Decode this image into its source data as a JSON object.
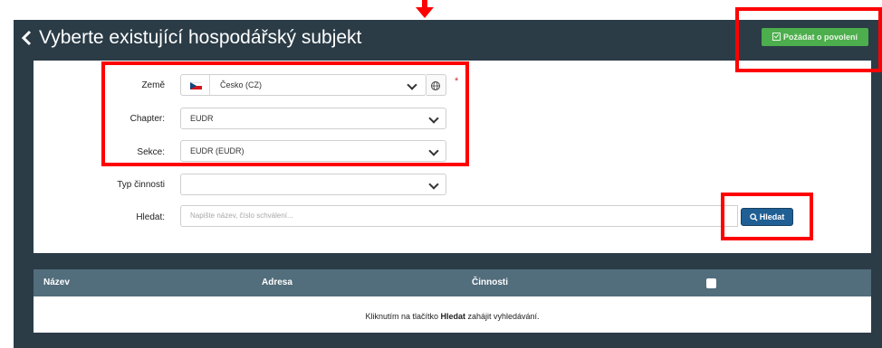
{
  "header": {
    "back_icon": "chevron-left-icon",
    "title": "Vyberte existující hospodářský subjekt",
    "request_permission_label": "Požádat o povolení"
  },
  "form": {
    "country": {
      "label": "Země",
      "value": "Česko (CZ)",
      "flag": "cz-flag-icon",
      "required_mark": "*"
    },
    "chapter": {
      "label": "Chapter:",
      "value": "EUDR"
    },
    "section": {
      "label": "Sekce:",
      "value": "EUDR (EUDR)"
    },
    "activity_type": {
      "label": "Typ činnosti",
      "value": ""
    },
    "search": {
      "label": "Hledat:",
      "placeholder": "Napište název, číslo schválení...",
      "button_label": "Hledat"
    }
  },
  "results": {
    "columns": [
      "Název",
      "Adresa",
      "Činnosti"
    ],
    "empty_message_before": "Kliknutím na tlačítko ",
    "empty_message_bold": "Hledat",
    "empty_message_after": " zahájit vyhledávání."
  },
  "colors": {
    "panel": "#2b3c47",
    "table_header": "#526d7c",
    "request_button": "#4cae4c",
    "search_button": "#1f5f94",
    "annotation": "#ff0000"
  }
}
